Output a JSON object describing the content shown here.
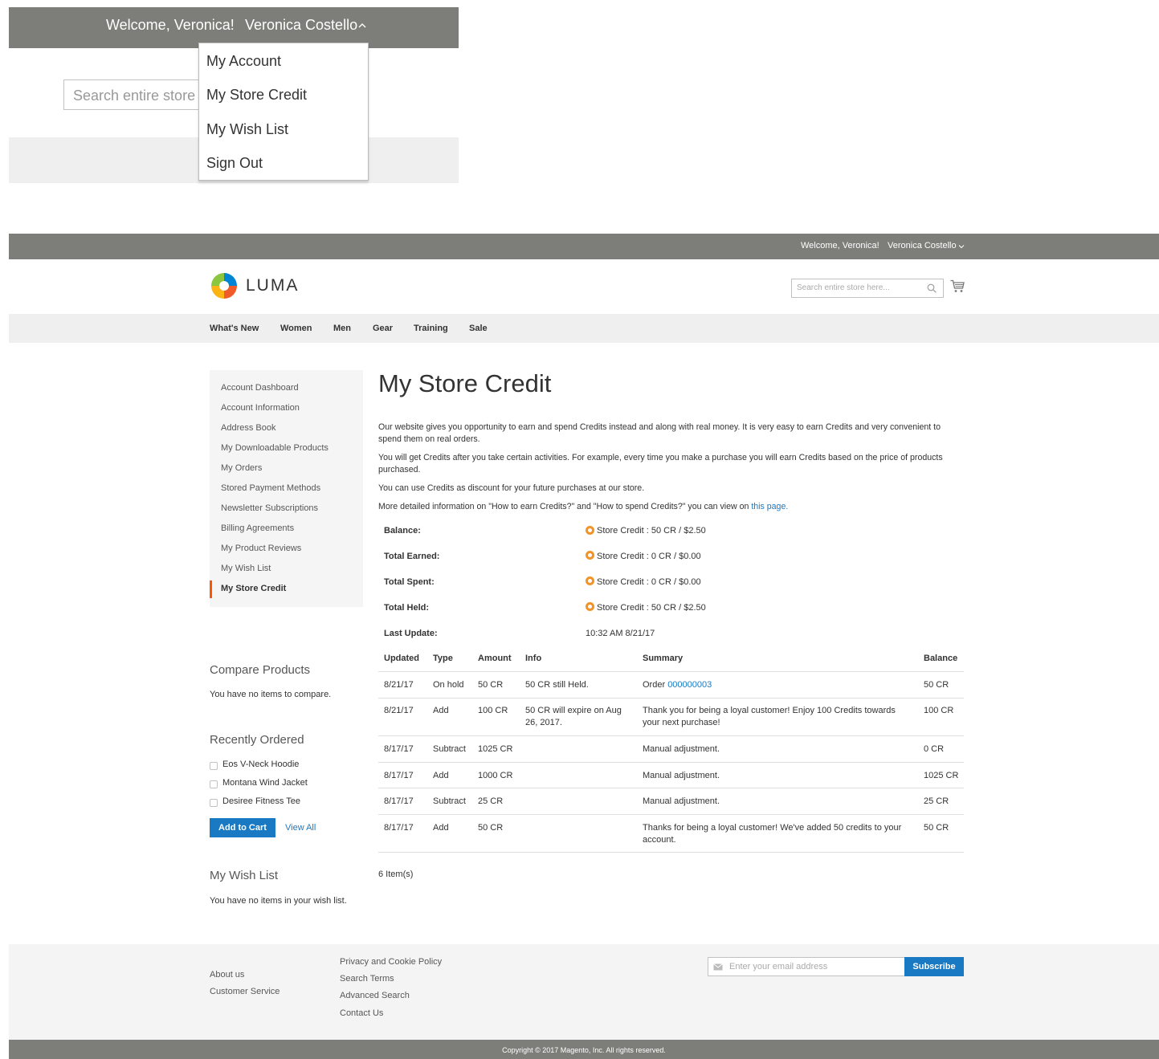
{
  "zoom": {
    "welcome": "Welcome, Veronica!",
    "customer_name": "Veronica Costello",
    "search_placeholder": "Search entire store",
    "dropdown": [
      "My Account",
      "My Store Credit",
      "My Wish List",
      "Sign Out"
    ]
  },
  "header": {
    "welcome": "Welcome, Veronica!",
    "customer_name": "Veronica Costello",
    "logo_text": "LUMA",
    "search_placeholder": "Search entire store here...",
    "icons": {
      "search": "search-icon",
      "cart": "cart-icon",
      "caret": "chevron-down-icon"
    }
  },
  "nav": [
    "What's New",
    "Women",
    "Men",
    "Gear",
    "Training",
    "Sale"
  ],
  "sidebar": {
    "items": [
      "Account Dashboard",
      "Account Information",
      "Address Book",
      "My Downloadable Products",
      "My Orders",
      "Stored Payment Methods",
      "Newsletter Subscriptions",
      "Billing Agreements",
      "My Product Reviews",
      "My Wish List",
      "My Store Credit"
    ],
    "active": "My Store Credit",
    "compare_title": "Compare Products",
    "compare_empty": "You have no items to compare.",
    "recent_title": "Recently Ordered",
    "recent_items": [
      "Eos V-Neck Hoodie",
      "Montana Wind Jacket",
      "Desiree Fitness Tee"
    ],
    "add_to_cart": "Add to Cart",
    "view_all": "View All",
    "wishlist_title": "My Wish List",
    "wishlist_empty": "You have no items in your wish list."
  },
  "main": {
    "title": "My Store Credit",
    "intro": [
      "Our website gives you opportunity to earn and spend Credits instead and along with real money. It is very easy to earn Credits and very convenient to spend them on real orders.",
      "You will get Credits after you take certain activities. For example, every time you make a purchase you will earn Credits based on the price of products purchased.",
      "You can use Credits as discount for your future purchases at our store."
    ],
    "more_info_text": "More detailed information on \"How to earn Credits?\" and \"How to spend Credits?\" you can view on ",
    "more_info_link": "this page.",
    "summary": {
      "balance_label": "Balance:",
      "balance_value": "Store Credit : 50 CR / $2.50",
      "earned_label": "Total Earned:",
      "earned_value": "Store Credit : 0 CR / $0.00",
      "spent_label": "Total Spent:",
      "spent_value": "Store Credit : 0 CR / $0.00",
      "held_label": "Total Held:",
      "held_value": "Store Credit : 50 CR / $2.50",
      "update_label": "Last Update:",
      "update_value": "10:32 AM 8/21/17",
      "icon": "credit-coin-icon"
    },
    "table": {
      "headers": {
        "updated": "Updated",
        "type": "Type",
        "amount": "Amount",
        "info": "Info",
        "summary": "Summary",
        "balance": "Balance"
      },
      "rows": [
        {
          "updated": "8/21/17",
          "type": "On hold",
          "amount": "50 CR",
          "info": "50 CR still Held.",
          "summary_prefix": "Order ",
          "summary_link": "000000003",
          "balance": "50 CR"
        },
        {
          "updated": "8/21/17",
          "type": "Add",
          "amount": "100 CR",
          "info": "50 CR will expire on Aug 26, 2017.",
          "summary": "Thank you for being a loyal customer! Enjoy 100 Credits towards your next purchase!",
          "balance": "100 CR"
        },
        {
          "updated": "8/17/17",
          "type": "Subtract",
          "amount": "1025 CR",
          "info": "",
          "summary": "Manual adjustment.",
          "balance": "0 CR"
        },
        {
          "updated": "8/17/17",
          "type": "Add",
          "amount": "1000 CR",
          "info": "",
          "summary": "Manual adjustment.",
          "balance": "1025 CR"
        },
        {
          "updated": "8/17/17",
          "type": "Subtract",
          "amount": "25 CR",
          "info": "",
          "summary": "Manual adjustment.",
          "balance": "25 CR"
        },
        {
          "updated": "8/17/17",
          "type": "Add",
          "amount": "50 CR",
          "info": "",
          "summary": "Thanks for being a loyal customer! We've added 50 credits to your account.",
          "balance": "50 CR"
        }
      ]
    },
    "items_count": "6 Item(s)"
  },
  "footer": {
    "col1": [
      "About us",
      "Customer Service"
    ],
    "col2": [
      "Privacy and Cookie Policy",
      "Search Terms",
      "Advanced Search",
      "Contact Us"
    ],
    "newsletter_placeholder": "Enter your email address",
    "subscribe": "Subscribe",
    "copyright": "Copyright © 2017 Magento, Inc. All rights reserved."
  },
  "colors": {
    "header_bar": "#7d7e7a",
    "accent_blue": "#1979c3",
    "active_marker": "#ff5501",
    "credit_icon": "#f39325"
  }
}
